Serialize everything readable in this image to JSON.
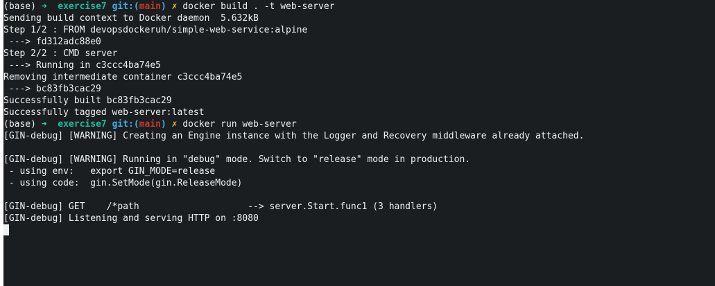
{
  "prompt": {
    "env": "(base)",
    "arrow": "➜",
    "dir": "exercise7",
    "git": "git:(",
    "branch": "main",
    "git_close": ")",
    "dirty": "✗"
  },
  "commands": {
    "build": "docker build . -t web-server",
    "run": "docker run web-server"
  },
  "output": {
    "l1": "Sending build context to Docker daemon  5.632kB",
    "l2": "Step 1/2 : FROM devopsdockeruh/simple-web-service:alpine",
    "l3": " ---> fd312adc88e0",
    "l4": "Step 2/2 : CMD server",
    "l5": " ---> Running in c3ccc4ba74e5",
    "l6": "Removing intermediate container c3ccc4ba74e5",
    "l7": " ---> bc83fb3cac29",
    "l8": "Successfully built bc83fb3cac29",
    "l9": "Successfully tagged web-server:latest",
    "g1": "[GIN-debug] [WARNING] Creating an Engine instance with the Logger and Recovery middleware already attached.",
    "g2": "",
    "g3": "[GIN-debug] [WARNING] Running in \"debug\" mode. Switch to \"release\" mode in production.",
    "g4": " - using env:   export GIN_MODE=release",
    "g5": " - using code:  gin.SetMode(gin.ReleaseMode)",
    "g6": "",
    "g7": "[GIN-debug] GET    /*path                    --> server.Start.func1 (3 handlers)",
    "g8": "[GIN-debug] Listening and serving HTTP on :8080"
  },
  "colors": {
    "background": "#1b1e20",
    "foreground": "#eff0f1",
    "arrow": "#1cdc9a",
    "dir": "#1abc9c",
    "git": "#3daee9",
    "branch": "#c0392b",
    "dirty": "#fdbc4b"
  }
}
